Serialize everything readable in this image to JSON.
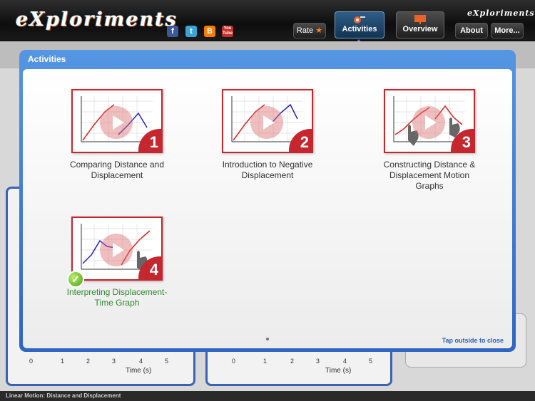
{
  "header": {
    "logo_text": "eXploriments",
    "brand_small": "eXploriments",
    "social": {
      "facebook": "f",
      "twitter": "t",
      "blogger": "B",
      "youtube": "You Tube"
    },
    "rate_label": "Rate",
    "tabs": [
      {
        "label": "Activities",
        "active": true
      },
      {
        "label": "Overview",
        "active": false
      }
    ],
    "about_label": "About",
    "more_label": "More..."
  },
  "background": {
    "x_axis_label": "Time (s)",
    "ticks": [
      "0",
      "1",
      "2",
      "3",
      "4",
      "5"
    ],
    "footer_text": "Linear Motion: Distance and Displacement"
  },
  "modal": {
    "title": "Activities",
    "close_hint": "Tap outside to close",
    "activities": [
      {
        "number": "1",
        "title_line1": "Comparing Distance and",
        "title_line2": "Displacement",
        "title_line3": "",
        "completed": false
      },
      {
        "number": "2",
        "title_line1": "Introduction to Negative",
        "title_line2": "Displacement",
        "title_line3": "",
        "completed": false
      },
      {
        "number": "3",
        "title_line1": "Constructing Distance &",
        "title_line2": "Displacement Motion",
        "title_line3": "Graphs",
        "completed": false
      },
      {
        "number": "4",
        "title_line1": "Interpreting Displacement-",
        "title_line2": "Time Graph",
        "title_line3": "",
        "completed": true
      }
    ]
  },
  "colors": {
    "accent": "#2d66c3",
    "thumb_border": "#c6262e",
    "done": "#2e8b2e"
  }
}
